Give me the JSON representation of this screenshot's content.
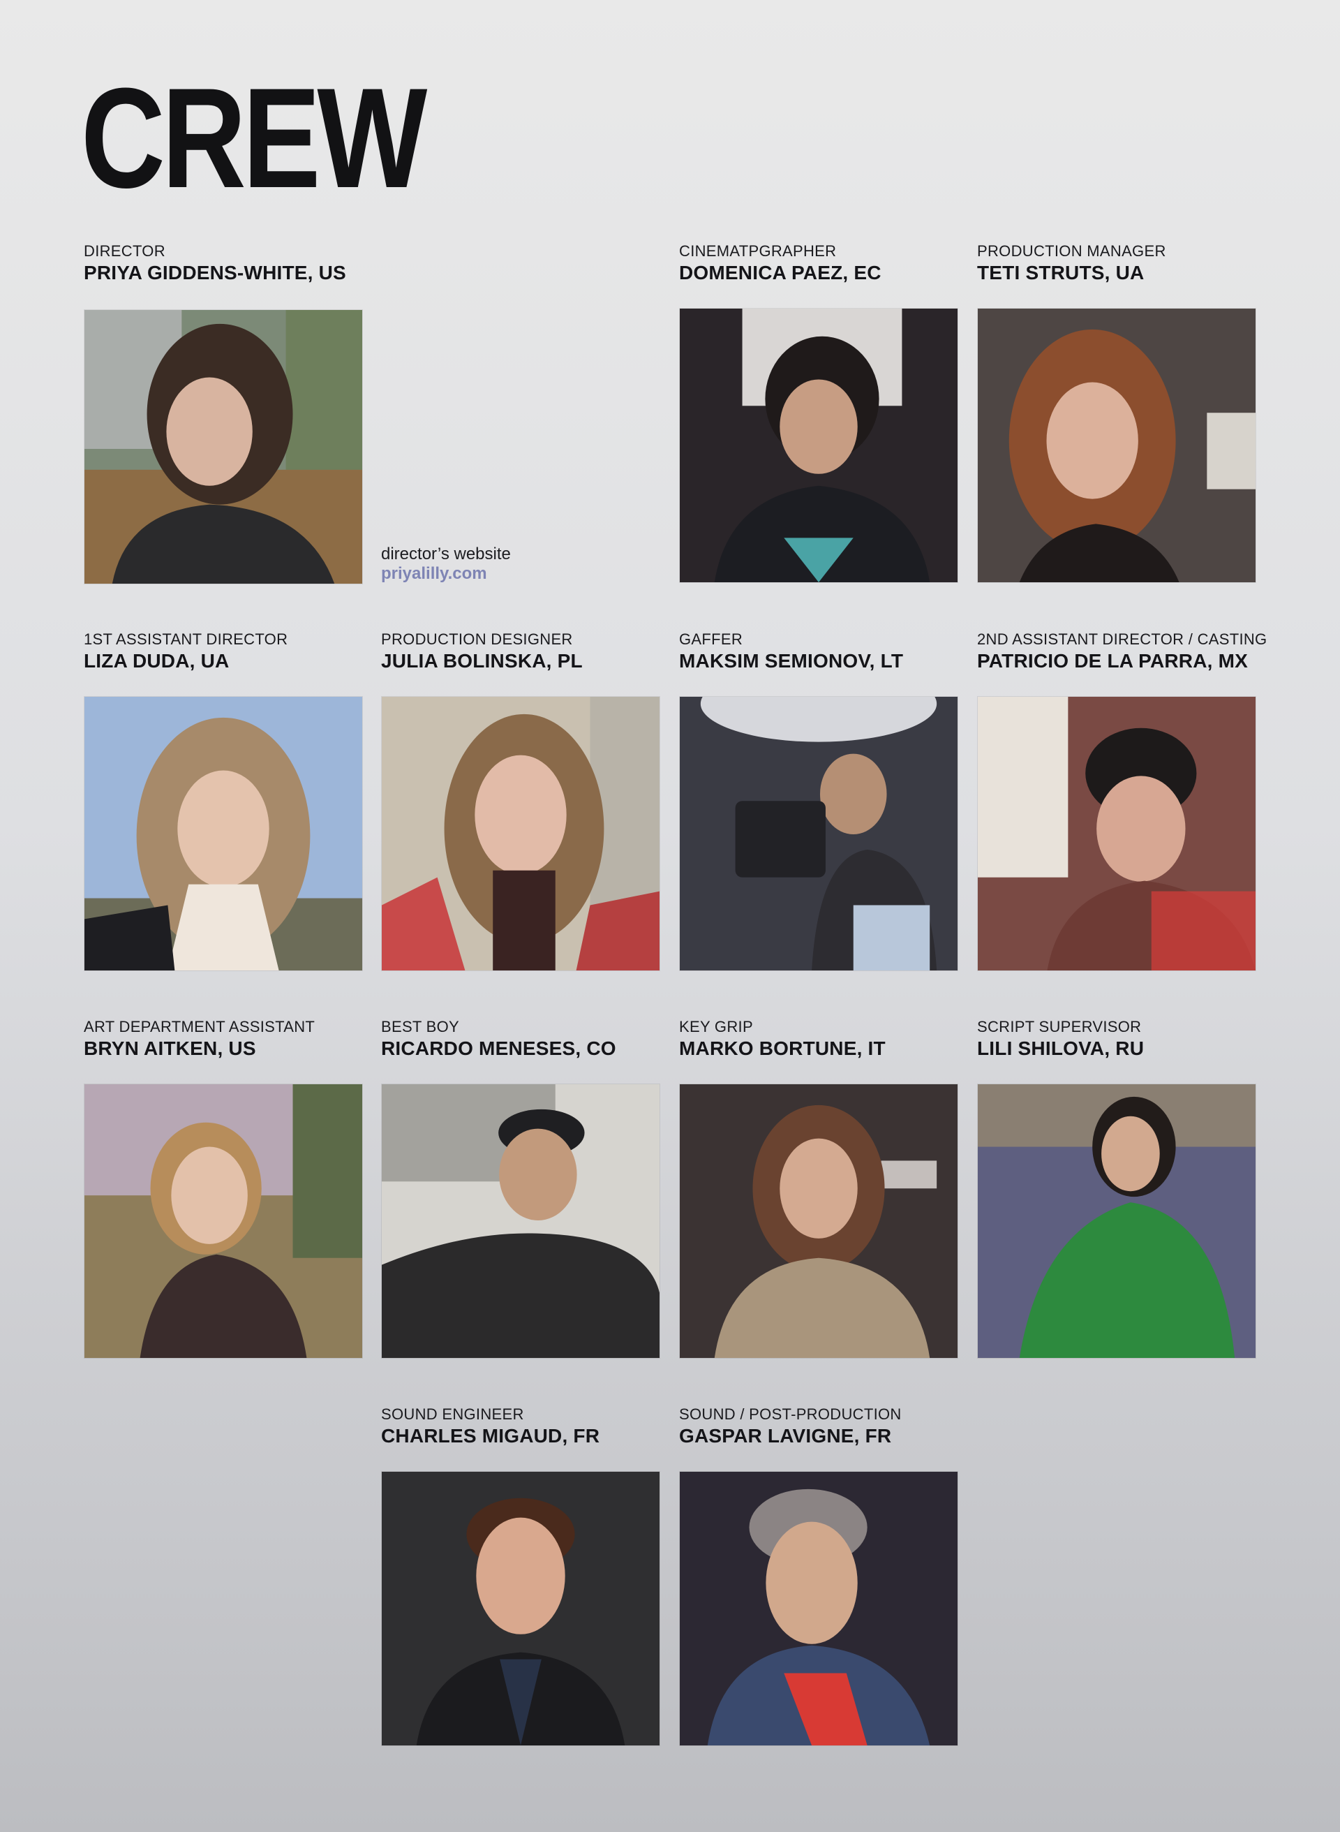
{
  "page": {
    "title": "CREW"
  },
  "website": {
    "label": "director’s website",
    "link": "priyalilly.com"
  },
  "crew": [
    {
      "role": "DIRECTOR",
      "name": "PRIYA GIDDENS-WHITE, US"
    },
    {
      "role": "CINEMATPGRAPHER",
      "name": "DOMENICA PAEZ, EC"
    },
    {
      "role": "PRODUCTION MANAGER",
      "name": "TETI STRUTS, UA"
    },
    {
      "role": "1ST ASSISTANT DIRECTOR",
      "name": "LIZA DUDA, UA"
    },
    {
      "role": "PRODUCTION DESIGNER",
      "name": "JULIA BOLINSKA, PL"
    },
    {
      "role": "GAFFER",
      "name": "MAKSIM SEMIONOV, LT"
    },
    {
      "role": "2ND ASSISTANT DIRECTOR / CASTING",
      "name": "PATRICIO DE LA PARRA, MX"
    },
    {
      "role": "ART DEPARTMENT ASSISTANT",
      "name": "BRYN AITKEN, US"
    },
    {
      "role": "BEST BOY",
      "name": "RICARDO MENESES, CO"
    },
    {
      "role": "KEY GRIP",
      "name": "MARKO BORTUNE, IT"
    },
    {
      "role": "SCRIPT SUPERVISOR",
      "name": "LILI SHILOVA, RU"
    },
    {
      "role": "SOUND ENGINEER",
      "name": "CHARLES MIGAUD, FR"
    },
    {
      "role": "SOUND / POST-PRODUCTION",
      "name": "GASPAR LAVIGNE, FR"
    }
  ]
}
